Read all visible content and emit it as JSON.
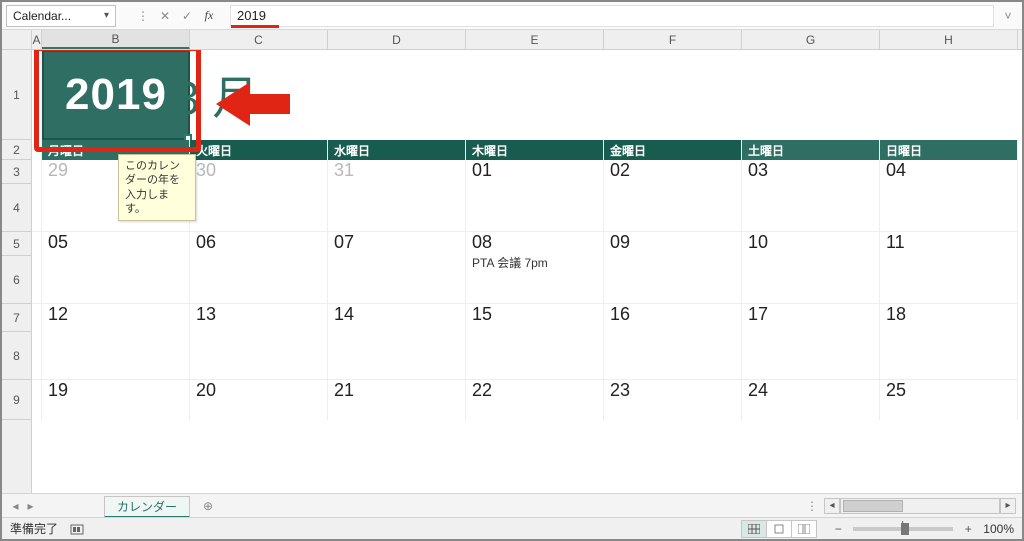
{
  "name_box": "Calendar...",
  "formula_value": "2019",
  "columns_visible": [
    "A",
    "B",
    "C",
    "D",
    "E",
    "F",
    "G",
    "H"
  ],
  "rows_visible": [
    "1",
    "2",
    "3",
    "4",
    "5",
    "6",
    "7",
    "8",
    "9"
  ],
  "year_value": "2019",
  "month_label": "3 月",
  "tooltip_text": "このカレンダーの年を入力します。",
  "dow": {
    "mon": "月曜日",
    "tue": "火曜日",
    "wed": "水曜日",
    "thu": "木曜日",
    "fri": "金曜日",
    "sat": "土曜日",
    "sun": "日曜日"
  },
  "week1": {
    "mon": "29",
    "tue": "30",
    "wed": "31",
    "thu": "01",
    "fri": "02",
    "sat": "03",
    "sun": "04"
  },
  "week2": {
    "mon": "05",
    "tue": "06",
    "wed": "07",
    "thu": "08",
    "fri": "09",
    "sat": "10",
    "sun": "11",
    "thu_event": "PTA 会議 7pm"
  },
  "week3": {
    "mon": "12",
    "tue": "13",
    "wed": "14",
    "thu": "15",
    "fri": "16",
    "sat": "17",
    "sun": "18"
  },
  "week4": {
    "mon": "19",
    "tue": "20",
    "wed": "21",
    "thu": "22",
    "fri": "23",
    "sat": "24",
    "sun": "25"
  },
  "sheet_tab": "カレンダー",
  "status_text": "準備完了",
  "zoom_label": "100%",
  "colors": {
    "brand_teal": "#2e6e63",
    "brand_dark": "#175c4f",
    "annotation_red": "#e02514"
  }
}
